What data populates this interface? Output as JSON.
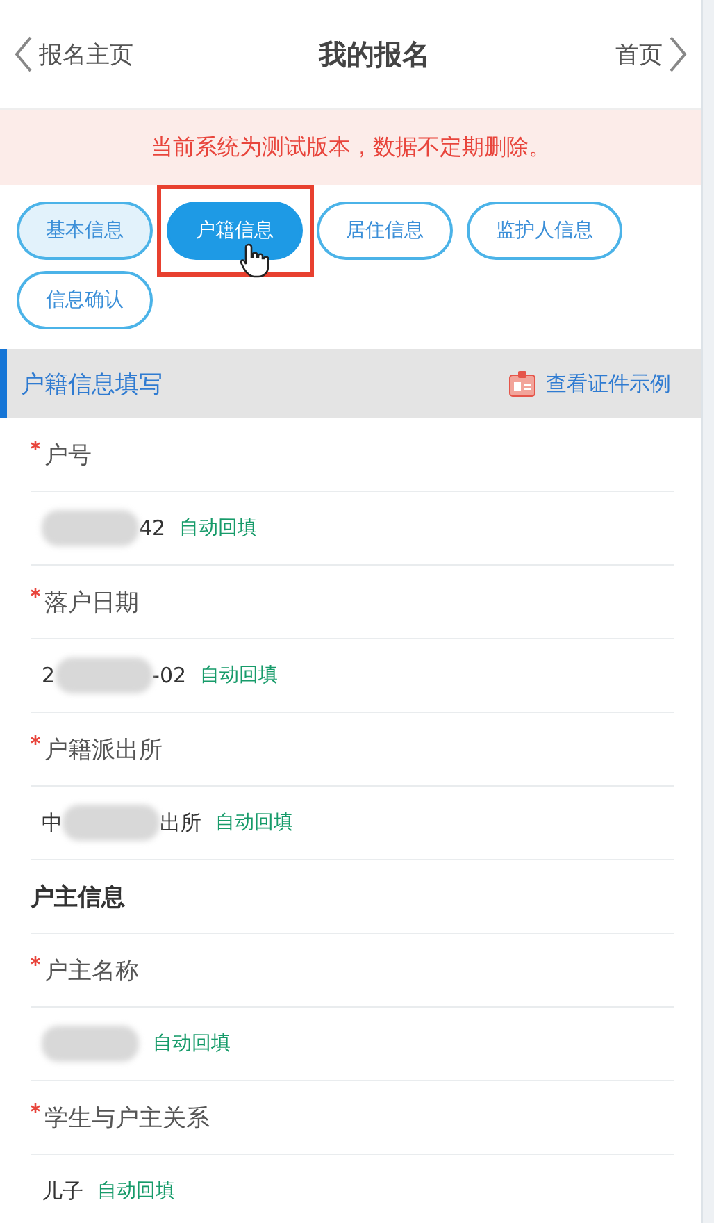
{
  "header": {
    "back": "报名主页",
    "title": "我的报名",
    "home": "首页"
  },
  "notice": "当前系统为测试版本，数据不定期删除。",
  "tabs": [
    {
      "label": "基本信息",
      "selected": false,
      "completed": true,
      "highlighted": false
    },
    {
      "label": "户籍信息",
      "selected": true,
      "completed": false,
      "highlighted": true
    },
    {
      "label": "居住信息",
      "selected": false,
      "completed": false,
      "highlighted": false
    },
    {
      "label": "监护人信息",
      "selected": false,
      "completed": false,
      "highlighted": false
    },
    {
      "label": "信息确认",
      "selected": false,
      "completed": false,
      "highlighted": false
    }
  ],
  "section": {
    "title": "户籍信息填写",
    "link": "查看证件示例",
    "items": [
      {
        "kind": "field",
        "label": "户号",
        "required": true,
        "value": {
          "after": "42",
          "redacted": true,
          "tag": "自动回填"
        }
      },
      {
        "kind": "field",
        "label": "落户日期",
        "required": true,
        "value": {
          "before": "2",
          "after": "-02",
          "redacted": true,
          "tag": "自动回填"
        }
      },
      {
        "kind": "field",
        "label": "户籍派出所",
        "required": true,
        "value": {
          "before": "中",
          "after": "出所",
          "redacted": true,
          "tag": "自动回填"
        }
      },
      {
        "kind": "heading",
        "label": "户主信息"
      },
      {
        "kind": "field",
        "label": "户主名称",
        "required": true,
        "value": {
          "redacted": true,
          "tag": "自动回填"
        }
      },
      {
        "kind": "field",
        "label": "学生与户主关系",
        "required": true,
        "value": {
          "after": "儿子",
          "redacted": false,
          "tag": "自动回填"
        }
      }
    ]
  }
}
